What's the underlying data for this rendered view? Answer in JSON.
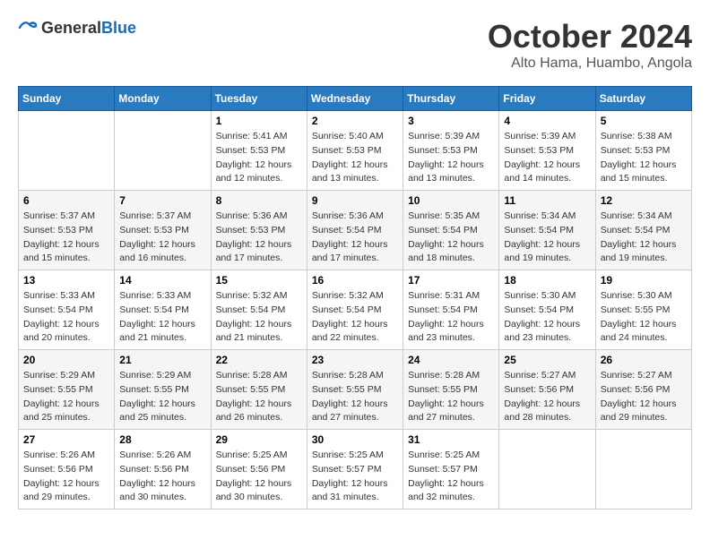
{
  "header": {
    "logo_general": "General",
    "logo_blue": "Blue",
    "month": "October 2024",
    "location": "Alto Hama, Huambo, Angola"
  },
  "days_of_week": [
    "Sunday",
    "Monday",
    "Tuesday",
    "Wednesday",
    "Thursday",
    "Friday",
    "Saturday"
  ],
  "weeks": [
    [
      null,
      null,
      {
        "day": "1",
        "sunrise": "5:41 AM",
        "sunset": "5:53 PM",
        "daylight": "12 hours and 12 minutes."
      },
      {
        "day": "2",
        "sunrise": "5:40 AM",
        "sunset": "5:53 PM",
        "daylight": "12 hours and 13 minutes."
      },
      {
        "day": "3",
        "sunrise": "5:39 AM",
        "sunset": "5:53 PM",
        "daylight": "12 hours and 13 minutes."
      },
      {
        "day": "4",
        "sunrise": "5:39 AM",
        "sunset": "5:53 PM",
        "daylight": "12 hours and 14 minutes."
      },
      {
        "day": "5",
        "sunrise": "5:38 AM",
        "sunset": "5:53 PM",
        "daylight": "12 hours and 15 minutes."
      }
    ],
    [
      {
        "day": "6",
        "sunrise": "5:37 AM",
        "sunset": "5:53 PM",
        "daylight": "12 hours and 15 minutes."
      },
      {
        "day": "7",
        "sunrise": "5:37 AM",
        "sunset": "5:53 PM",
        "daylight": "12 hours and 16 minutes."
      },
      {
        "day": "8",
        "sunrise": "5:36 AM",
        "sunset": "5:53 PM",
        "daylight": "12 hours and 17 minutes."
      },
      {
        "day": "9",
        "sunrise": "5:36 AM",
        "sunset": "5:54 PM",
        "daylight": "12 hours and 17 minutes."
      },
      {
        "day": "10",
        "sunrise": "5:35 AM",
        "sunset": "5:54 PM",
        "daylight": "12 hours and 18 minutes."
      },
      {
        "day": "11",
        "sunrise": "5:34 AM",
        "sunset": "5:54 PM",
        "daylight": "12 hours and 19 minutes."
      },
      {
        "day": "12",
        "sunrise": "5:34 AM",
        "sunset": "5:54 PM",
        "daylight": "12 hours and 19 minutes."
      }
    ],
    [
      {
        "day": "13",
        "sunrise": "5:33 AM",
        "sunset": "5:54 PM",
        "daylight": "12 hours and 20 minutes."
      },
      {
        "day": "14",
        "sunrise": "5:33 AM",
        "sunset": "5:54 PM",
        "daylight": "12 hours and 21 minutes."
      },
      {
        "day": "15",
        "sunrise": "5:32 AM",
        "sunset": "5:54 PM",
        "daylight": "12 hours and 21 minutes."
      },
      {
        "day": "16",
        "sunrise": "5:32 AM",
        "sunset": "5:54 PM",
        "daylight": "12 hours and 22 minutes."
      },
      {
        "day": "17",
        "sunrise": "5:31 AM",
        "sunset": "5:54 PM",
        "daylight": "12 hours and 23 minutes."
      },
      {
        "day": "18",
        "sunrise": "5:30 AM",
        "sunset": "5:54 PM",
        "daylight": "12 hours and 23 minutes."
      },
      {
        "day": "19",
        "sunrise": "5:30 AM",
        "sunset": "5:55 PM",
        "daylight": "12 hours and 24 minutes."
      }
    ],
    [
      {
        "day": "20",
        "sunrise": "5:29 AM",
        "sunset": "5:55 PM",
        "daylight": "12 hours and 25 minutes."
      },
      {
        "day": "21",
        "sunrise": "5:29 AM",
        "sunset": "5:55 PM",
        "daylight": "12 hours and 25 minutes."
      },
      {
        "day": "22",
        "sunrise": "5:28 AM",
        "sunset": "5:55 PM",
        "daylight": "12 hours and 26 minutes."
      },
      {
        "day": "23",
        "sunrise": "5:28 AM",
        "sunset": "5:55 PM",
        "daylight": "12 hours and 27 minutes."
      },
      {
        "day": "24",
        "sunrise": "5:28 AM",
        "sunset": "5:55 PM",
        "daylight": "12 hours and 27 minutes."
      },
      {
        "day": "25",
        "sunrise": "5:27 AM",
        "sunset": "5:56 PM",
        "daylight": "12 hours and 28 minutes."
      },
      {
        "day": "26",
        "sunrise": "5:27 AM",
        "sunset": "5:56 PM",
        "daylight": "12 hours and 29 minutes."
      }
    ],
    [
      {
        "day": "27",
        "sunrise": "5:26 AM",
        "sunset": "5:56 PM",
        "daylight": "12 hours and 29 minutes."
      },
      {
        "day": "28",
        "sunrise": "5:26 AM",
        "sunset": "5:56 PM",
        "daylight": "12 hours and 30 minutes."
      },
      {
        "day": "29",
        "sunrise": "5:25 AM",
        "sunset": "5:56 PM",
        "daylight": "12 hours and 30 minutes."
      },
      {
        "day": "30",
        "sunrise": "5:25 AM",
        "sunset": "5:57 PM",
        "daylight": "12 hours and 31 minutes."
      },
      {
        "day": "31",
        "sunrise": "5:25 AM",
        "sunset": "5:57 PM",
        "daylight": "12 hours and 32 minutes."
      },
      null,
      null
    ]
  ],
  "labels": {
    "sunrise": "Sunrise:",
    "sunset": "Sunset:",
    "daylight": "Daylight: 12 hours"
  }
}
